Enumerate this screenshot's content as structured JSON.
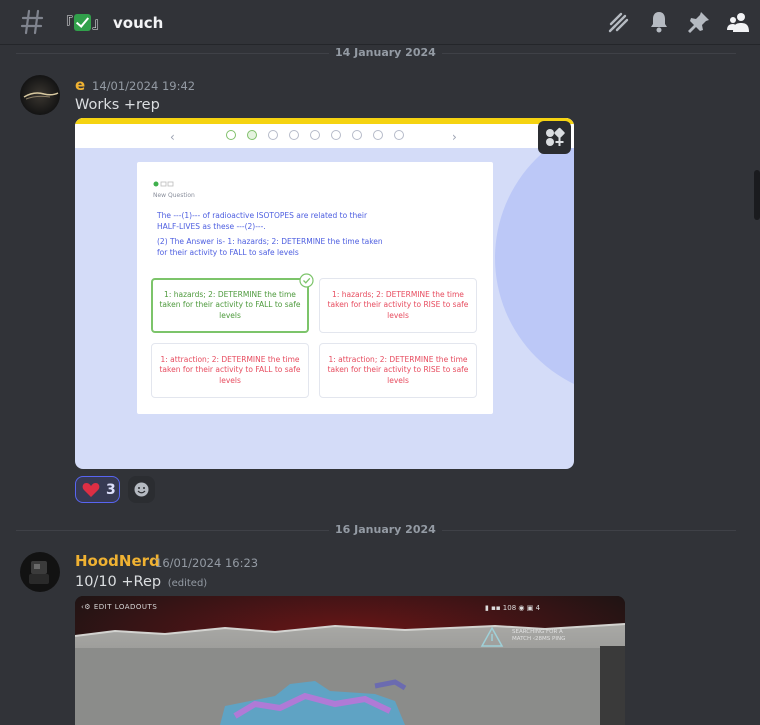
{
  "header": {
    "channel_prefix": "『",
    "channel_suffix": "』",
    "channel_name": "vouch",
    "icons": [
      "threads-icon",
      "bell-icon",
      "pin-icon",
      "members-icon"
    ]
  },
  "dividers": [
    "14 January 2024",
    "16 January 2024"
  ],
  "messages": [
    {
      "username": "e",
      "timestamp": "14/01/2024 19:42",
      "text": "Works +rep",
      "attachment": {
        "label": "New Question",
        "question_1": "The ---(1)--- of radioactive ISOTOPES are related to their HALF-LIVES as these ---(2)---.",
        "question_2": "(2) The Answer is- 1: hazards; 2: DETERMINE the time taken for their activity to FALL to safe levels",
        "options": [
          "1: hazards; 2: DETERMINE the time taken for their activity to FALL to safe levels",
          "1: hazards; 2: DETERMINE the time taken for their activity to RISE to safe levels",
          "1: attraction; 2: DETERMINE the time taken for their activity to FALL to safe levels",
          "1: attraction; 2: DETERMINE the time taken for their activity to RISE to safe levels"
        ],
        "progress_dots": 9,
        "completed_dots": 2
      },
      "reactions": [
        {
          "emoji": "heart",
          "count": "3"
        }
      ]
    },
    {
      "username": "HoodNerd",
      "timestamp": "16/01/2024 16:23",
      "text": "10/10 +Rep",
      "edited": "(edited)",
      "attachment": {
        "menu": "EDIT LOADOUTS",
        "stat_value": "108",
        "player_count": "4",
        "status_line_1": "SEARCHING FOR A",
        "status_line_2": "MATCH ‹28MS PING"
      }
    }
  ],
  "colors": {
    "background": "#313338",
    "username": "#f0b232",
    "reaction_border": "#5865f2",
    "correct": "#7cc46a",
    "wrong": "#e74c5f"
  }
}
